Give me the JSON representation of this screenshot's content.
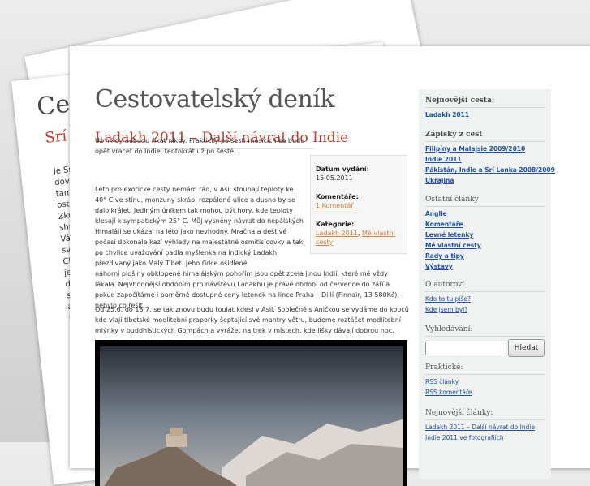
{
  "back_page": {
    "title": "Ces",
    "subtitle": "Srí La",
    "lines": [
      "Je Srí La",
      "dovole",
      "tam vá",
      "ostrov",
      "Zkusi",
      "shrnu",
      "Válka",
      "světc",
      "CNN",
      "je t",
      "der",
      "se",
      "al",
      "na"
    ]
  },
  "site": {
    "title": "Cestovatelský deník"
  },
  "post": {
    "title": "Ladakh 2011 – Další návrat do Indie",
    "p1": "Už nikdy nebudu říkat nikdy. Prakticky po šesti měsících se budu opět vracet do Indie, tentokrát už po šesté…",
    "p2": "Léto pro exotické cesty nemám rád, v Asii stoupají teploty ke 40° C ve stínu, monzuny skrápí rozpálené ulice a dusno by se dalo krájet. Jediným únikem tak mohou být hory, kde teploty klesají k sympatickým 25° C. Můj vysněný návrat do nepálských Himalájí se ukázal na léto jako nevhodný. Mračna a deštivé počasí dokonale kazí výhledy na majestátné osmitisícovky a tak po chvilce uvažování padla myšlenka na indický Ladakh přezdívaný jako Malý Tibet. Jeho řídce osídlené",
    "p2b": "náhorní plošiny obklopené himalájským pohořím jsou opět zcela jinou Indií, které mě vždy lákala. Nejvhodnější obdobím pro návštěvu Ladakhu je právě období od července do září a pokud započítáme i poměrně dostupné ceny letenek na lince Praha – Dillí (Finnair, 13 580Kč), nebylo co řešit.",
    "p3": "Od 25.6. do 18.7. se tak znovu budu toulat kdesi v Asii. Společně s Aničkou se vydáme do kopců kde vlají tibetské modlitební praporky šeptající své mantry větru, budeme roztáčet modlitební mlýnky v buddhistických Gompách a vyrážet na trek v místech, kde lišky dávají dobrou noc."
  },
  "meta": {
    "date_label": "Datum vydání:",
    "date": "15.05.2011",
    "comments_label": "Komentáře:",
    "comments_link": "1 Komentář",
    "category_label": "Kategorie:",
    "category_1": "Ladakh 2011",
    "category_sep": ", ",
    "category_2": "Mé vlastní",
    "category_3": "cesty"
  },
  "sidebar": {
    "latest_trip_heading": "Nejnovější cesta:",
    "latest_trip_link": "Ladakh 2011",
    "notes_heading": "Zápisky z cest",
    "notes_links": [
      "Filipíny a Malajsie 2009/2010",
      "Indie 2011",
      "Pákistán, Indie a Srí Lanka 2008/2009",
      "Ukrajina"
    ],
    "other_heading": "Ostatní články",
    "other_links": [
      "Anglie",
      "Komentáře",
      "Levné letenky",
      "Mé vlastní cesty",
      "Rady a tipy",
      "Výstavy"
    ],
    "author_heading": "O autorovi",
    "author_links": [
      "Kdo to tu píše?",
      "Kde jsem byl?"
    ],
    "search_heading": "Vyhledávání:",
    "search_button": "Hledat",
    "practical_heading": "Praktické:",
    "practical_links": [
      "RSS články",
      "RSS komentáře"
    ],
    "newest_heading": "Nejnovější články:",
    "newest_links": [
      "Ladakh 2011 – Další návrat do Indie",
      "Indie 2011 ve fotografiích"
    ]
  },
  "colors": {
    "post_title": "#c0392b",
    "link_blue": "#1f4ea3",
    "meta_link": "#d08040"
  }
}
